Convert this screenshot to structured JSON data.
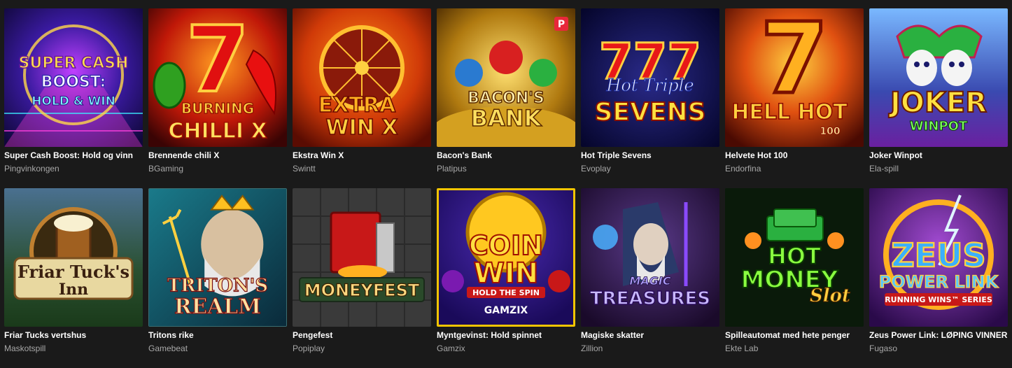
{
  "games": [
    {
      "title": "Super Cash Boost: Hold og vinn",
      "provider": "Pingvinkongen",
      "art": "super-cash-boost-art",
      "logo": [
        "SUPER CASH",
        "BOOST:",
        "HOLD & WIN"
      ]
    },
    {
      "title": "Brennende chili X",
      "provider": "BGaming",
      "art": "burning-chilli-art",
      "logo": [
        "BURNING",
        "CHILLI X"
      ]
    },
    {
      "title": "Ekstra Win X",
      "provider": "Swintt",
      "art": "extra-win-art",
      "logo": [
        "EXTRA",
        "WIN X"
      ]
    },
    {
      "title": "Bacon's Bank",
      "provider": "Platipus",
      "art": "bacons-bank-art",
      "logo": [
        "BACON'S",
        "BANK"
      ]
    },
    {
      "title": "Hot Triple Sevens",
      "provider": "Evoplay",
      "art": "hot-triple-sevens-art",
      "logo": [
        "Hot Triple",
        "SEVENS"
      ]
    },
    {
      "title": "Helvete Hot 100",
      "provider": "Endorfina",
      "art": "hell-hot-art",
      "logo": [
        "HELL HOT",
        "100"
      ]
    },
    {
      "title": "Joker Winpot",
      "provider": "Ela-spill",
      "art": "joker-winpot-art",
      "logo": [
        "JOKER",
        "WINPOT"
      ]
    },
    {
      "title": "Friar Tucks vertshus",
      "provider": "Maskotspill",
      "art": "friar-tucks-inn-art",
      "logo": [
        "Friar Tuck's",
        "Inn"
      ]
    },
    {
      "title": "Tritons rike",
      "provider": "Gamebeat",
      "art": "tritons-realm-art",
      "logo": [
        "TRITON'S",
        "REALM"
      ]
    },
    {
      "title": "Pengefest",
      "provider": "Popiplay",
      "art": "moneyfest-art",
      "logo": [
        "MONEYFEST"
      ]
    },
    {
      "title": "Myntgevinst: Hold spinnet",
      "provider": "Gamzix",
      "art": "coin-win-art",
      "logo": [
        "COIN",
        "WIN",
        "HOLD THE SPIN",
        "GAMZIX"
      ]
    },
    {
      "title": "Magiske skatter",
      "provider": "Zillion",
      "art": "magic-treasures-art",
      "logo": [
        "MAGIC",
        "TREASURES"
      ]
    },
    {
      "title": "Spilleautomat med hete penger",
      "provider": "Ekte Lab",
      "art": "hot-money-slot-art",
      "logo": [
        "HOT",
        "MONEY",
        "Slot"
      ]
    },
    {
      "title": "Zeus Power Link: LØPING VINNER",
      "provider": "Fugaso",
      "art": "zeus-power-link-art",
      "logo": [
        "ZEUS",
        "POWER LINK",
        "RUNNING WINS™ SERIES"
      ]
    }
  ],
  "badge": "P",
  "colors": {
    "background": "#1a1a1a",
    "title": "#ffffff",
    "provider": "#a8a8a8",
    "selected_border": "#f2c500"
  }
}
